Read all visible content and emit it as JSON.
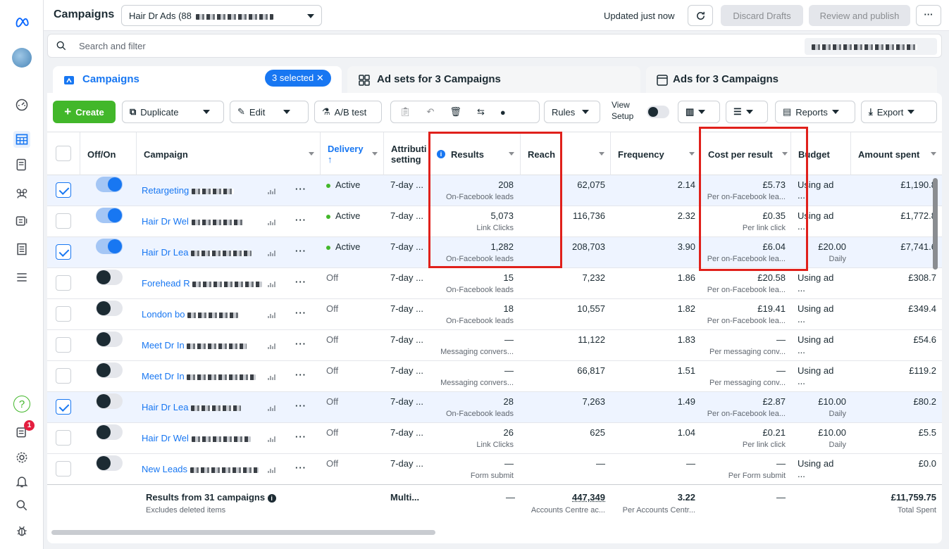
{
  "topbar": {
    "title": "Campaigns",
    "account": "Hair Dr Ads (88",
    "updated": "Updated just now",
    "discard": "Discard Drafts",
    "review": "Review and publish",
    "more": "···"
  },
  "search": {
    "placeholder": "Search and filter"
  },
  "tabs": {
    "campaigns": "Campaigns",
    "selected": "3 selected",
    "adsets": "Ad sets for 3 Campaigns",
    "ads": "Ads for 3 Campaigns"
  },
  "toolbar": {
    "create": "Create",
    "duplicate": "Duplicate",
    "edit": "Edit",
    "abtest": "A/B test",
    "rules": "Rules",
    "view_setup": "View\nSetup",
    "view_label_1": "View",
    "view_label_2": "Setup",
    "reports": "Reports",
    "export": "Export"
  },
  "columns": {
    "offon": "Off/On",
    "campaign": "Campaign",
    "delivery": "Delivery",
    "delivery_arrow": "↑",
    "attribution_1": "Attributi",
    "attribution_2": "setting",
    "results": "Results",
    "reach": "Reach",
    "frequency": "Frequency",
    "cpr": "Cost per result",
    "budget": "Budget",
    "amount": "Amount spent"
  },
  "rows": [
    {
      "checked": true,
      "on": true,
      "name": "Retargeting",
      "delivery": "Active",
      "attr": "7-day ...",
      "results": "208",
      "results_sub": "On-Facebook leads",
      "reach": "62,075",
      "freq": "2.14",
      "cpr": "£5.73",
      "cpr_sub": "Per on-Facebook lea...",
      "budget": "Using ad ...",
      "budget_sub": "",
      "amount": "£1,190.8"
    },
    {
      "checked": false,
      "on": true,
      "name": "Hair Dr Wel",
      "delivery": "Active",
      "attr": "7-day ...",
      "results": "5,073",
      "results_sub": "Link Clicks",
      "reach": "116,736",
      "freq": "2.32",
      "cpr": "£0.35",
      "cpr_sub": "Per link click",
      "budget": "Using ad ...",
      "budget_sub": "",
      "amount": "£1,772.8"
    },
    {
      "checked": true,
      "on": true,
      "name": "Hair Dr Lea",
      "delivery": "Active",
      "attr": "7-day ...",
      "results": "1,282",
      "results_sub": "On-Facebook leads",
      "reach": "208,703",
      "freq": "3.90",
      "cpr": "£6.04",
      "cpr_sub": "Per on-Facebook lea...",
      "budget": "£20.00",
      "budget_sub": "Daily",
      "amount": "£7,741.6"
    },
    {
      "checked": false,
      "on": false,
      "name": "Forehead R",
      "delivery": "Off",
      "attr": "7-day ...",
      "results": "15",
      "results_sub": "On-Facebook leads",
      "reach": "7,232",
      "freq": "1.86",
      "cpr": "£20.58",
      "cpr_sub": "Per on-Facebook lea...",
      "budget": "Using ad ...",
      "budget_sub": "",
      "amount": "£308.7"
    },
    {
      "checked": false,
      "on": false,
      "name": "London bo",
      "delivery": "Off",
      "attr": "7-day ...",
      "results": "18",
      "results_sub": "On-Facebook leads",
      "reach": "10,557",
      "freq": "1.82",
      "cpr": "£19.41",
      "cpr_sub": "Per on-Facebook lea...",
      "budget": "Using ad ...",
      "budget_sub": "",
      "amount": "£349.4"
    },
    {
      "checked": false,
      "on": false,
      "name": "Meet Dr In",
      "delivery": "Off",
      "attr": "7-day ...",
      "results": "—",
      "results_sub": "Messaging convers...",
      "reach": "11,122",
      "freq": "1.83",
      "cpr": "—",
      "cpr_sub": "Per messaging conv...",
      "budget": "Using ad ...",
      "budget_sub": "",
      "amount": "£54.6"
    },
    {
      "checked": false,
      "on": false,
      "name": "Meet Dr In",
      "delivery": "Off",
      "attr": "7-day ...",
      "results": "—",
      "results_sub": "Messaging convers...",
      "reach": "66,817",
      "freq": "1.51",
      "cpr": "—",
      "cpr_sub": "Per messaging conv...",
      "budget": "Using ad ...",
      "budget_sub": "",
      "amount": "£119.2"
    },
    {
      "checked": true,
      "on": false,
      "name": "Hair Dr Lea",
      "delivery": "Off",
      "attr": "7-day ...",
      "results": "28",
      "results_sub": "On-Facebook leads",
      "reach": "7,263",
      "freq": "1.49",
      "cpr": "£2.87",
      "cpr_sub": "Per on-Facebook lea...",
      "budget": "£10.00",
      "budget_sub": "Daily",
      "amount": "£80.2"
    },
    {
      "checked": false,
      "on": false,
      "name": "Hair Dr Wel",
      "delivery": "Off",
      "attr": "7-day ...",
      "results": "26",
      "results_sub": "Link Clicks",
      "reach": "625",
      "freq": "1.04",
      "cpr": "£0.21",
      "cpr_sub": "Per link click",
      "budget": "£10.00",
      "budget_sub": "Daily",
      "amount": "£5.5"
    },
    {
      "checked": false,
      "on": false,
      "name": "New Leads",
      "delivery": "Off",
      "attr": "7-day ...",
      "results": "—",
      "results_sub": "Form submit",
      "reach": "—",
      "freq": "—",
      "cpr": "—",
      "cpr_sub": "Per Form submit",
      "budget": "Using ad ...",
      "budget_sub": "",
      "amount": "£0.0"
    }
  ],
  "footer": {
    "title": "Results from 31 campaigns",
    "sub": "Excludes deleted items",
    "attr": "Multi...",
    "results": "—",
    "reach": "447,349",
    "reach_sub": "Accounts Centre ac...",
    "freq": "3.22",
    "freq_sub": "Per Accounts Centr...",
    "cpr": "—",
    "amount": "£11,759.75",
    "amount_sub": "Total Spent"
  },
  "rail": {
    "notification_count": "1"
  },
  "colors": {
    "accent": "#1877f2",
    "create": "#42b72a",
    "highlight": "#e0201b"
  }
}
